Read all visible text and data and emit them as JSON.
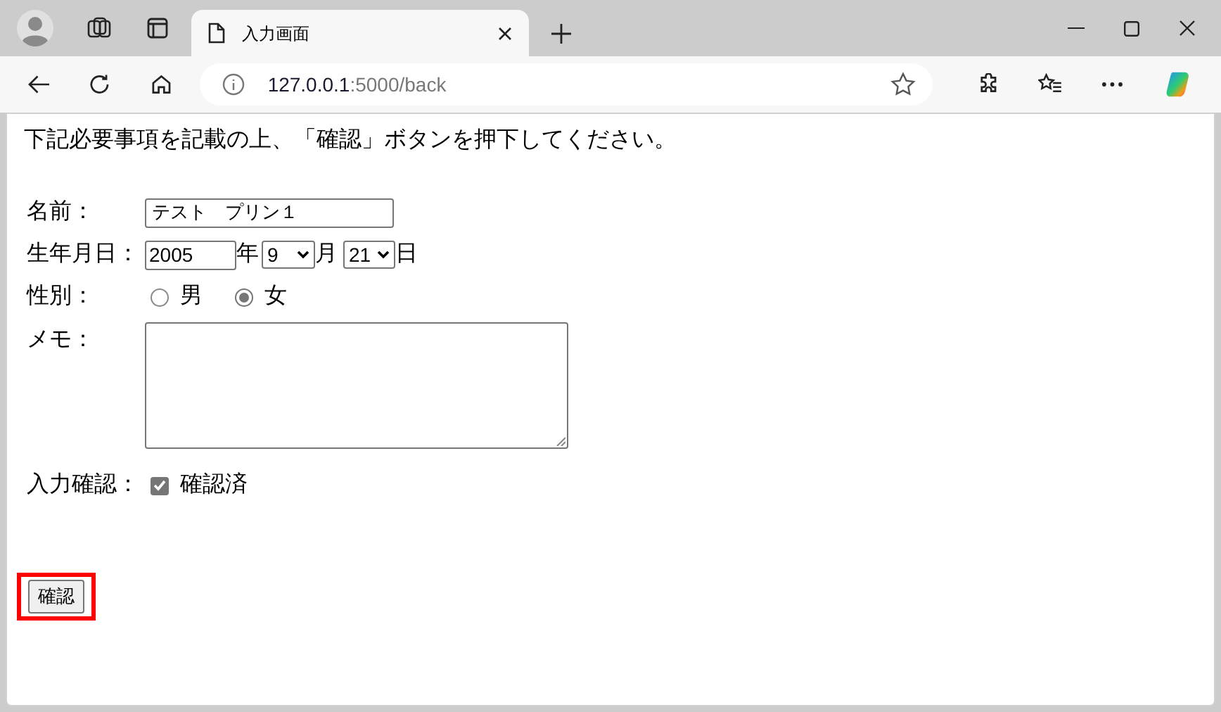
{
  "browser": {
    "tab": {
      "title": "入力画面",
      "selected": true
    },
    "address": {
      "host": "127.0.0.1",
      "path": ":5000/back"
    }
  },
  "page": {
    "intro": "下記必要事項を記載の上、「確認」ボタンを押下してください。",
    "name": {
      "label": "名前：",
      "value": "テスト　プリン１"
    },
    "birth": {
      "label": "生年月日：",
      "year": "2005",
      "year_unit": "年",
      "month": "9",
      "month_unit": "月",
      "day": "21",
      "day_unit": "日"
    },
    "gender": {
      "label": "性別：",
      "options": [
        {
          "label": "男",
          "selected": false
        },
        {
          "label": "女",
          "selected": true
        }
      ]
    },
    "memo": {
      "label": "メモ："
    },
    "confirm": {
      "label": "入力確認：",
      "option": "確認済",
      "checked": true
    },
    "submit": {
      "label": "確認",
      "highlighted": true
    }
  }
}
